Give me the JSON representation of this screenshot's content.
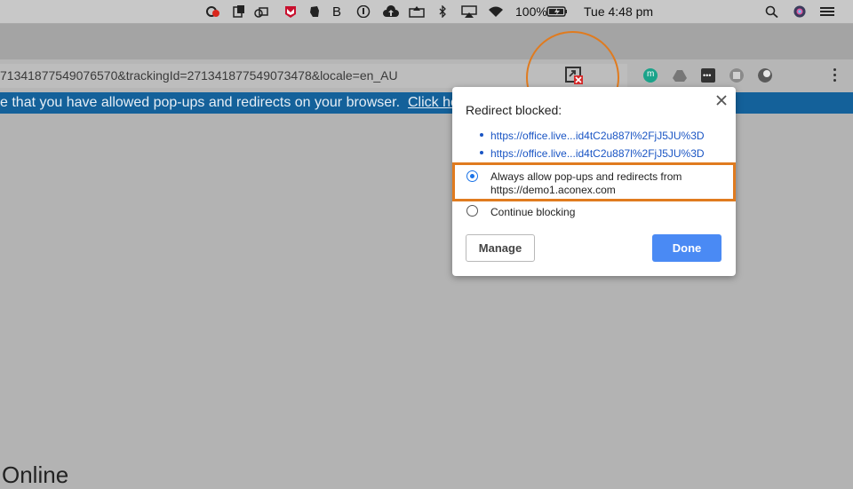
{
  "menubar": {
    "battery": "100%",
    "clock": "Tue 4:48 pm",
    "icons": [
      "creative-cloud-icon",
      "clipboard-icon",
      "sync-icon",
      "mcafee-icon",
      "evernote-icon",
      "bold-b-icon",
      "info-icon",
      "cloud-upload-icon",
      "upload-tray-icon",
      "bluetooth-icon",
      "airplay-icon",
      "wifi-icon",
      "battery-icon",
      "search-icon",
      "siri-icon",
      "menu-list-icon"
    ]
  },
  "toolbar": {
    "url": "71341877549076570&trackingId=271341877549073478&locale=en_AU",
    "extensions": [
      "m-extension-icon",
      "drive-extension-icon",
      "dots-extension-icon",
      "puzzle-extension-icon",
      "circle-extension-icon"
    ],
    "blocked_icon": "popup-blocked-icon"
  },
  "banner": {
    "text": "e that you have allowed pop-ups and redirects on your browser.",
    "link": "Click he"
  },
  "page": {
    "bottom_text": "Online"
  },
  "popup": {
    "title": "Redirect blocked:",
    "links": [
      "https://office.live...id4tC2u887l%2FjJ5JU%3D",
      "https://office.live...id4tC2u887l%2FjJ5JU%3D"
    ],
    "option_allow_line1": "Always allow pop-ups and redirects from",
    "option_allow_line2": "https://demo1.aconex.com",
    "option_block": "Continue blocking",
    "selected_option": "allow",
    "manage_label": "Manage",
    "done_label": "Done"
  },
  "colors": {
    "highlight": "#e07b1f",
    "banner": "#14619a",
    "primary_button": "#4a8af4",
    "link": "#1a55c4"
  }
}
